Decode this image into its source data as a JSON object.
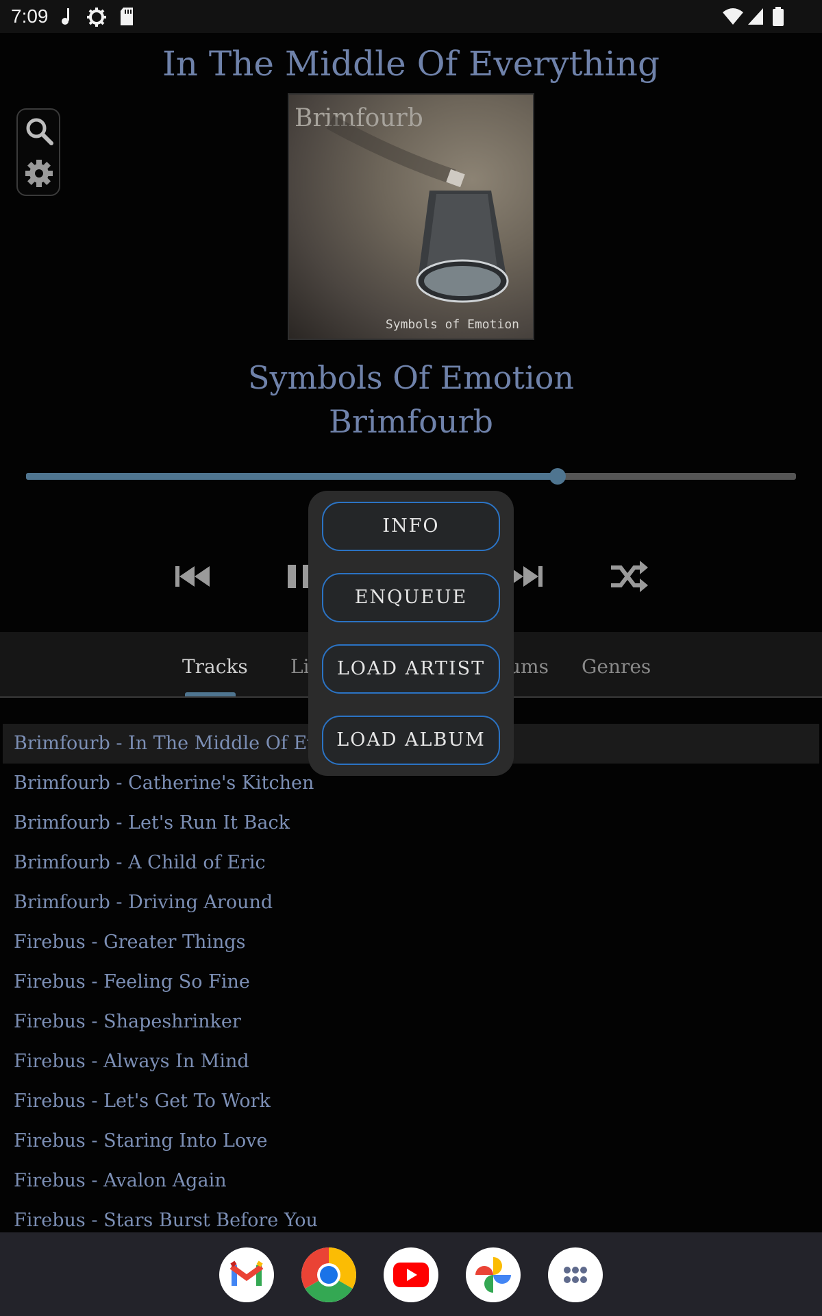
{
  "status_bar": {
    "time": "7:09",
    "left_icons": [
      "music-note-icon",
      "settings-gear-icon",
      "sd-card-icon"
    ],
    "right_icons": [
      "wifi-icon",
      "cell-signal-icon",
      "battery-icon"
    ]
  },
  "now_playing": {
    "title": "In The Middle Of Everything",
    "album": "Symbols Of Emotion",
    "artist": "Brimfourb",
    "cover_text_artist": "Brimfourb",
    "cover_text_album": "Symbols of Emotion",
    "progress": 0.69
  },
  "tools": [
    "search-icon",
    "gear-icon"
  ],
  "transport": [
    "previous-icon",
    "pause-icon",
    "next-icon",
    "shuffle-icon"
  ],
  "tabs": {
    "items": [
      "Tracks",
      "Li",
      "ums",
      "Genres"
    ],
    "active": "Tracks"
  },
  "popup_menu": {
    "items": [
      "INFO",
      "ENQUEUE",
      "LOAD ARTIST",
      "LOAD ALBUM"
    ]
  },
  "tracks": [
    "Brimfourb - In The Middle Of Everyt",
    "Brimfourb - Catherine's Kitchen",
    "Brimfourb - Let's Run It Back",
    "Brimfourb - A Child of Eric",
    "Brimfourb - Driving Around",
    "Firebus - Greater Things",
    "Firebus - Feeling So Fine",
    "Firebus - Shapeshrinker",
    "Firebus - Always In Mind",
    "Firebus - Let's Get To Work",
    "Firebus - Staring Into Love",
    "Firebus - Avalon Again",
    "Firebus - Stars Burst Before You"
  ],
  "dock": [
    "gmail-icon",
    "chrome-icon",
    "youtube-icon",
    "photos-icon",
    "app-drawer-icon"
  ],
  "colors": {
    "accent": "#4f7590",
    "text_blue": "#7c8fb5",
    "popup_border": "#2b73c4"
  }
}
